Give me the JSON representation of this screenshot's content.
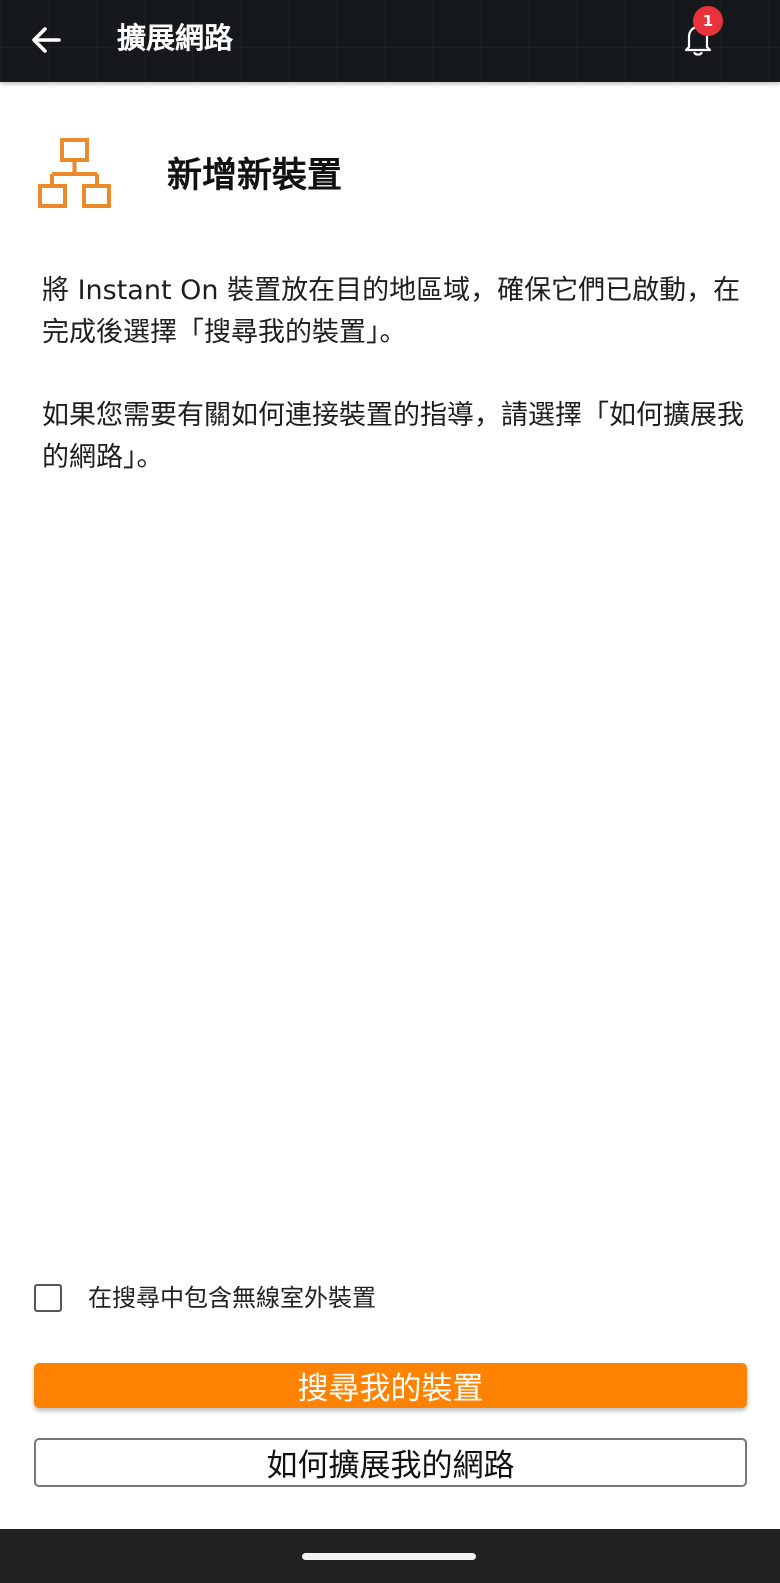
{
  "header": {
    "title": "擴展網路",
    "notification_count": "1"
  },
  "section": {
    "title": "新增新裝置"
  },
  "instructions": {
    "paragraph_1": "將 Instant On 裝置放在目的地區域，確保它們已啟動，在完成後選擇「搜尋我的裝置」。",
    "paragraph_2": "如果您需要有關如何連接裝置的指導，請選擇「如何擴展我的網路」。"
  },
  "options": {
    "include_outdoor_label": "在搜尋中包含無線室外裝置",
    "include_outdoor_checked": false
  },
  "buttons": {
    "search_label": "搜尋我的裝置",
    "how_to_label": "如何擴展我的網路"
  },
  "icons": {
    "back": "arrow-left-icon",
    "notifications": "bell-icon",
    "section": "network-topology-icon"
  },
  "colors": {
    "accent": "#ff8300",
    "header_bg": "#16191c",
    "badge": "#e8323c"
  }
}
